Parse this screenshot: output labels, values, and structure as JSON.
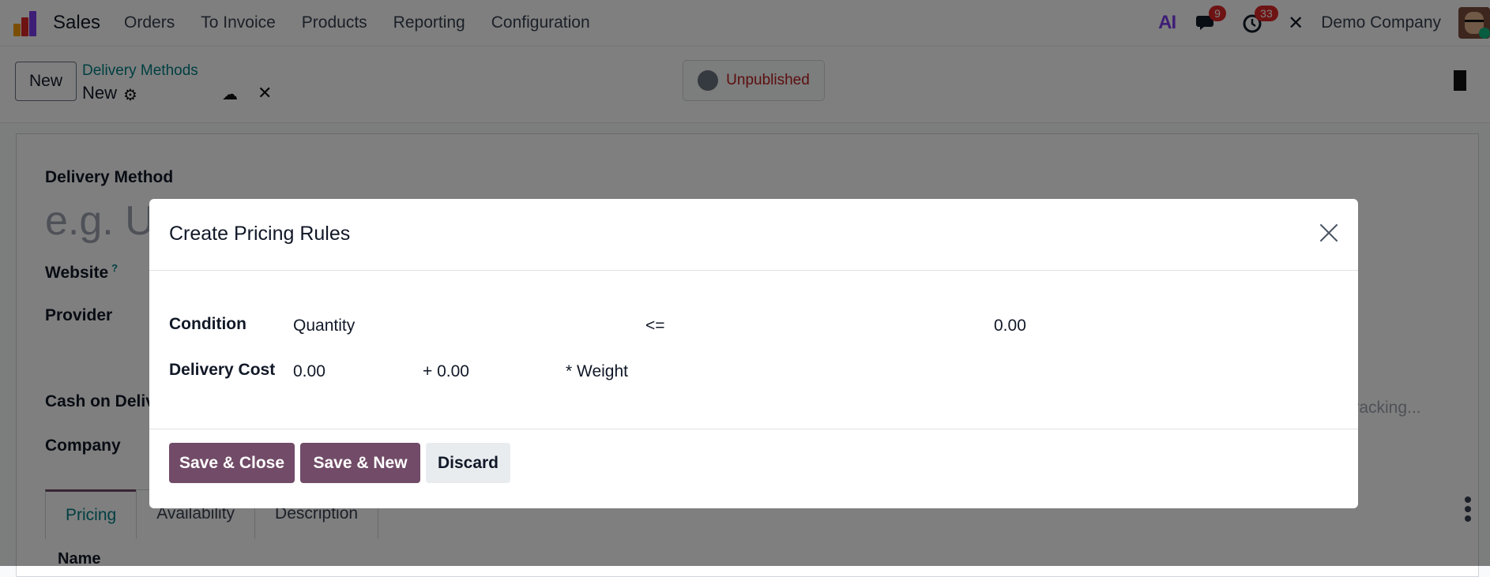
{
  "navbar": {
    "app_title": "Sales",
    "menu": [
      "Orders",
      "To Invoice",
      "Products",
      "Reporting",
      "Configuration"
    ],
    "ai_label": "AI",
    "messages_count": "9",
    "activities_count": "33",
    "company": "Demo Company"
  },
  "control": {
    "new_label": "New",
    "breadcrumb": "Delivery Methods",
    "record_title": "New",
    "status_label": "Unpublished"
  },
  "form": {
    "delivery_method_label": "Delivery Method",
    "delivery_method_placeholder": "e.g. U",
    "website_label": "Website",
    "website_help": "?",
    "provider_label": "Provider",
    "cod_label": "Cash on Deliv",
    "company_label": "Company",
    "tracking_placeholder": "attracking...",
    "tabs": [
      "Pricing",
      "Availability",
      "Description"
    ],
    "list_column": "Name"
  },
  "modal": {
    "title": "Create Pricing Rules",
    "condition_label": "Condition",
    "condition_variable": "Quantity",
    "condition_operator": "<=",
    "condition_value": "0.00",
    "cost_label": "Delivery Cost",
    "cost_fixed": "0.00",
    "cost_factor": "+ 0.00",
    "cost_variable": "* Weight",
    "save_close": "Save & Close",
    "save_new": "Save & New",
    "discard": "Discard"
  },
  "colors": {
    "brand": "#714b67",
    "link": "#017e84",
    "badge": "#dc2626"
  }
}
